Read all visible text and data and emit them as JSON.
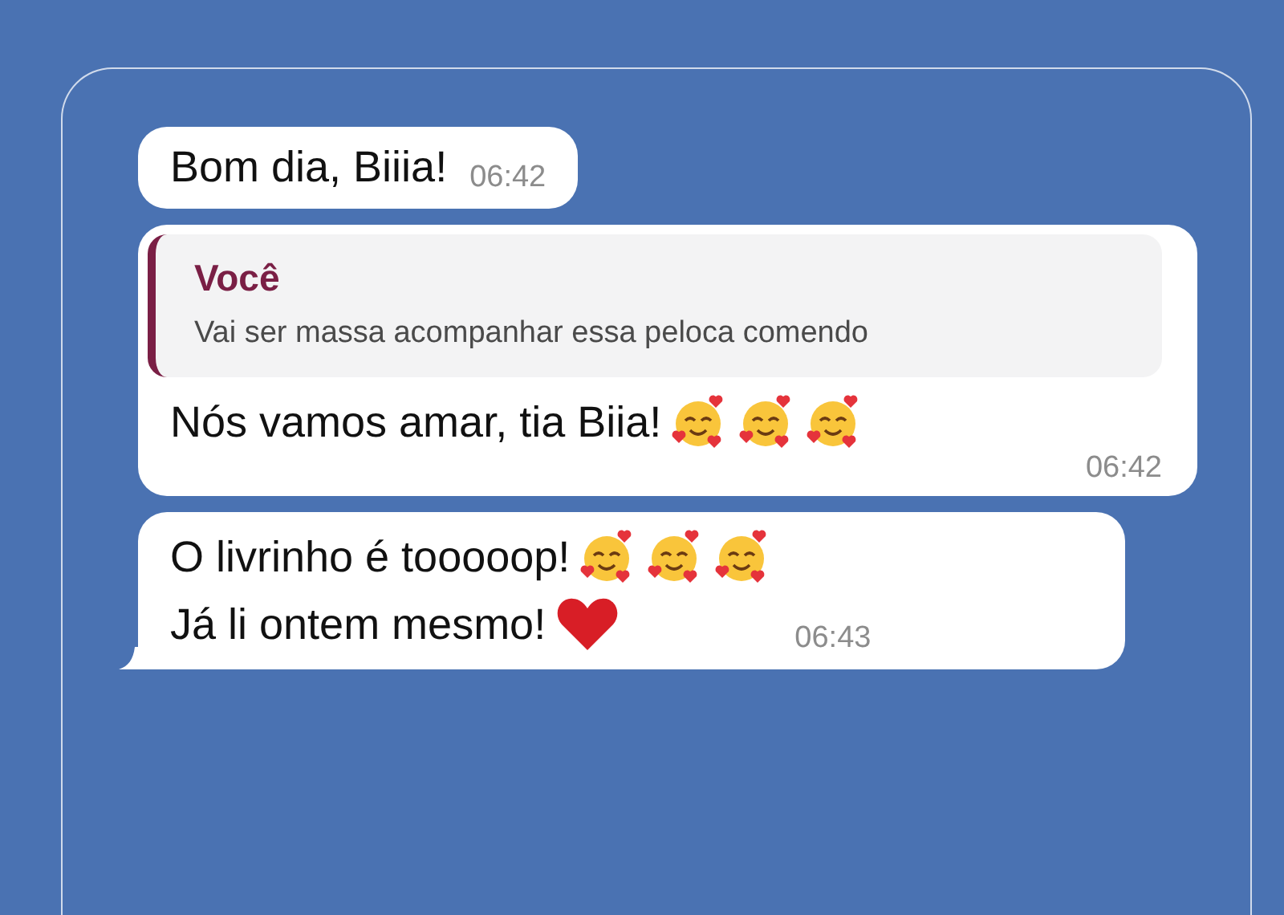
{
  "messages": [
    {
      "lines": [
        {
          "text": "Bom dia, Biiia!"
        }
      ],
      "time": "06:42",
      "tail": false
    },
    {
      "reply": {
        "author": "Você",
        "text": "Vai ser massa acompanhar essa peloca comendo"
      },
      "lines": [
        {
          "text": "Nós vamos amar, tia Biia!",
          "emojis": [
            {
              "kind": "smiling-hearts"
            },
            {
              "kind": "smiling-hearts"
            },
            {
              "kind": "smiling-hearts"
            }
          ]
        }
      ],
      "time": "06:42",
      "tail": false
    },
    {
      "lines": [
        {
          "text": "O livrinho é tooooop!",
          "emojis": [
            {
              "kind": "smiling-hearts"
            },
            {
              "kind": "smiling-hearts"
            },
            {
              "kind": "smiling-hearts"
            }
          ]
        },
        {
          "text": "Já li ontem mesmo!",
          "emojis": [
            {
              "kind": "heart"
            }
          ]
        }
      ],
      "time": "06:43",
      "tail": true
    }
  ]
}
